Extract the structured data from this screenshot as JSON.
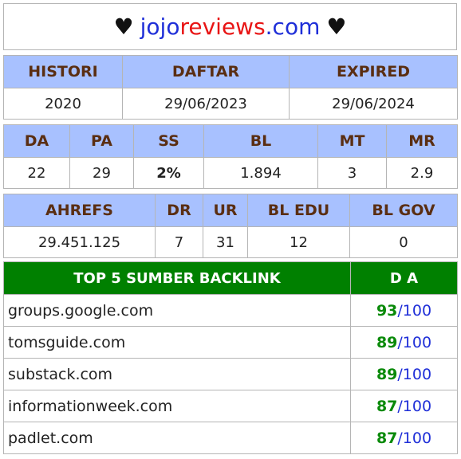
{
  "title": {
    "heart_left": "♥",
    "site_part1": "jojo",
    "site_part2": "reviews",
    "site_part3": ".com",
    "heart_right": "♥"
  },
  "registration": {
    "headers": [
      "HISTORI",
      "DAFTAR",
      "EXPIRED"
    ],
    "values": [
      "2020",
      "29/06/2023",
      "29/06/2024"
    ]
  },
  "metrics": {
    "headers": [
      "DA",
      "PA",
      "SS",
      "BL",
      "MT",
      "MR"
    ],
    "values": [
      "22",
      "29",
      "2%",
      "1.894",
      "3",
      "2.9"
    ]
  },
  "ahrefs": {
    "headers": [
      "AHREFS",
      "DR",
      "UR",
      "BL EDU",
      "BL GOV"
    ],
    "values": [
      "29.451.125",
      "7",
      "31",
      "12",
      "0"
    ]
  },
  "backlinks": {
    "header_source": "TOP 5 SUMBER BACKLINK",
    "header_da": "D A",
    "rows": [
      {
        "site": "groups.google.com",
        "score": "93",
        "max": "/100"
      },
      {
        "site": "tomsguide.com",
        "score": "89",
        "max": "/100"
      },
      {
        "site": "substack.com",
        "score": "89",
        "max": "/100"
      },
      {
        "site": "informationweek.com",
        "score": "87",
        "max": "/100"
      },
      {
        "site": "padlet.com",
        "score": "87",
        "max": "/100"
      }
    ]
  },
  "colors": {
    "header_bg": "#a8c1ff",
    "header_text": "#5a2e12",
    "backlink_header_bg": "#008000",
    "score_green": "#0a8a0a",
    "link_blue": "#1f2fd8",
    "brand_red": "#e81414"
  }
}
